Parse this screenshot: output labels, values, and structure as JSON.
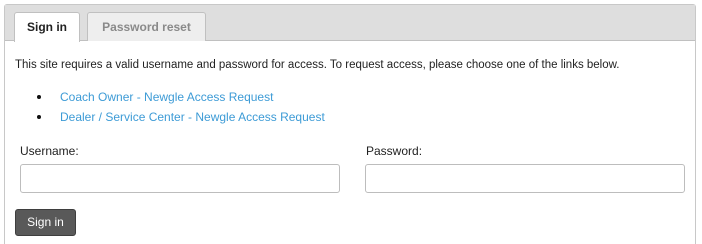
{
  "tabs": {
    "signin": "Sign in",
    "password_reset": "Password reset"
  },
  "intro_text": "This site requires a valid username and password for access.  To request access, please choose one of the links below.",
  "links": [
    "Coach Owner - Newgle Access Request",
    "Dealer / Service Center - Newgle Access Request"
  ],
  "form": {
    "username_label": "Username:",
    "password_label": "Password:",
    "username_value": "",
    "password_value": "",
    "signin_button": "Sign in"
  },
  "colors": {
    "link": "#3d9bd6",
    "button": "#595959",
    "tabbar": "#dedede"
  }
}
